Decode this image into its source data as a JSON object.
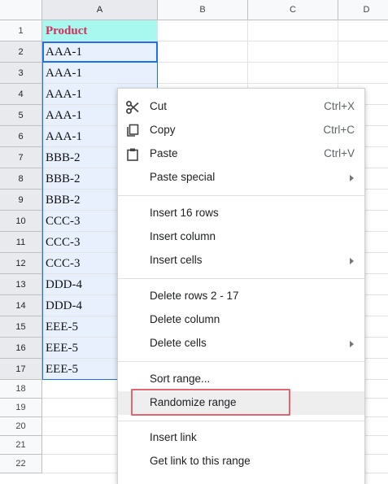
{
  "columns": [
    "A",
    "B",
    "C",
    "D"
  ],
  "rows": [
    "1",
    "2",
    "3",
    "4",
    "5",
    "6",
    "7",
    "8",
    "9",
    "10",
    "11",
    "12",
    "13",
    "14",
    "15",
    "16",
    "17",
    "18",
    "19",
    "20",
    "21",
    "22"
  ],
  "column_a": [
    "Product",
    "AAA-1",
    "AAA-1",
    "AAA-1",
    "AAA-1",
    "AAA-1",
    "BBB-2",
    "BBB-2",
    "BBB-2",
    "CCC-3",
    "CCC-3",
    "CCC-3",
    "DDD-4",
    "DDD-4",
    "EEE-5",
    "EEE-5",
    "EEE-5"
  ],
  "menu": {
    "cut": {
      "label": "Cut",
      "shortcut": "Ctrl+X"
    },
    "copy": {
      "label": "Copy",
      "shortcut": "Ctrl+C"
    },
    "paste": {
      "label": "Paste",
      "shortcut": "Ctrl+V"
    },
    "paste_special": {
      "label": "Paste special"
    },
    "insert_rows": {
      "label": "Insert 16 rows"
    },
    "insert_column": {
      "label": "Insert column"
    },
    "insert_cells": {
      "label": "Insert cells"
    },
    "delete_rows": {
      "label": "Delete rows 2 - 17"
    },
    "delete_column": {
      "label": "Delete column"
    },
    "delete_cells": {
      "label": "Delete cells"
    },
    "sort_range": {
      "label": "Sort range..."
    },
    "randomize_range": {
      "label": "Randomize range"
    },
    "insert_link": {
      "label": "Insert link"
    },
    "get_link": {
      "label": "Get link to this range"
    }
  },
  "colors": {
    "header_fill": "#a8f8f0",
    "header_text": "#d0305a",
    "selection_fill": "#e8f0fe",
    "selection_border": "#1a73e8",
    "annotation_box": "#e06670"
  },
  "icons": {
    "cut": "scissors-icon",
    "copy": "copy-icon",
    "paste": "clipboard-icon"
  }
}
